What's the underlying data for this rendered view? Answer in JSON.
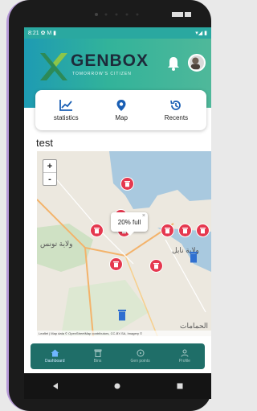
{
  "status_bar": {
    "time": "8:21",
    "left_icons": "✿ M ▮",
    "right_icons": "▾◢ ▮"
  },
  "header": {
    "logo_text": "GENBOX",
    "logo_subtitle": "TOMORROW'S CITIZEN",
    "notification_icon": "bell-icon",
    "avatar_icon": "avatar"
  },
  "quick_actions": [
    {
      "label": "statistics",
      "icon": "chart-icon"
    },
    {
      "label": "Map",
      "icon": "location-pin-icon"
    },
    {
      "label": "Recents",
      "icon": "history-icon"
    }
  ],
  "section_title": "test",
  "map": {
    "zoom_in": "+",
    "zoom_out": "-",
    "popup_text": "20% full",
    "popup_close": "×",
    "labels": [
      "ولاية تونس",
      "ولاية نابل",
      "الحمامات"
    ],
    "attribution": "Leaflet | Map data © OpenStreetMap contributors, CC-BY-SA, Imagery ©"
  },
  "bottom_nav": [
    {
      "label": "Dashboard",
      "icon": "home-icon",
      "active": true
    },
    {
      "label": "Bins",
      "icon": "bin-icon",
      "active": false
    },
    {
      "label": "Gen points",
      "icon": "coin-icon",
      "active": false
    },
    {
      "label": "Profile",
      "icon": "user-icon",
      "active": false
    }
  ],
  "colors": {
    "header_start": "#1e9bb3",
    "header_end": "#4fb89a",
    "pin_red": "#e5384f",
    "nav_bg": "#1f6e68"
  }
}
